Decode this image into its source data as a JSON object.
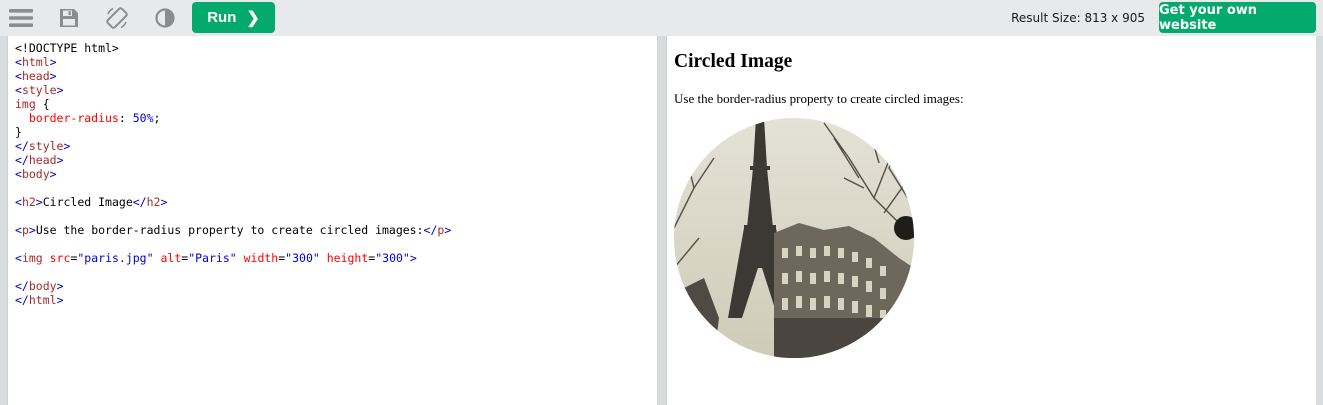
{
  "toolbar": {
    "icons": [
      "menu-icon",
      "save-icon",
      "rotate-icon",
      "contrast-icon"
    ],
    "run_label": "Run",
    "run_chevron": "❯",
    "result_size": "Result Size: 813 x 905",
    "get_website_label": "Get your own website",
    "accent_color": "#04aa6d"
  },
  "editor": {
    "lines": [
      "<!DOCTYPE html>",
      "<html>",
      "<head>",
      "<style>",
      "img {",
      "  border-radius: 50%;",
      "}",
      "</style>",
      "</head>",
      "<body>",
      "",
      "<h2>Circled Image</h2>",
      "",
      "<p>Use the border-radius property to create circled images:</p>",
      "",
      "<img src=\"paris.jpg\" alt=\"Paris\" width=\"300\" height=\"300\">",
      "",
      "</body>",
      "</html>"
    ]
  },
  "result": {
    "heading": "Circled Image",
    "paragraph": "Use the border-radius property to create circled images:",
    "image_alt": "Paris",
    "image_description": "eiffel-tower-photo"
  }
}
